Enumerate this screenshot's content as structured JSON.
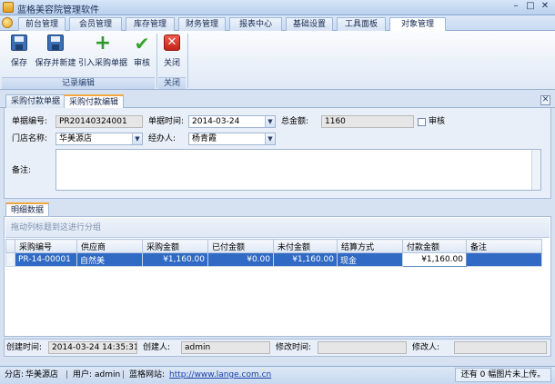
{
  "window": {
    "title": "蓝格美容院管理软件",
    "min": "–",
    "max": "□",
    "close": "✕"
  },
  "menu_tabs": [
    "前台管理",
    "会员管理",
    "库存管理",
    "财务管理",
    "报表中心",
    "基础设置",
    "工具面板",
    "对象管理"
  ],
  "ribbon": {
    "save": "保存",
    "save_new": "保存并新建",
    "import_po": "引入采购单据",
    "approve": "审核",
    "close": "关闭",
    "group_record": "记录编辑",
    "group_close": "关闭"
  },
  "doc_tabs": [
    "采购付款单据",
    "采购付款编辑"
  ],
  "form": {
    "doc_no_label": "单据编号:",
    "doc_no": "PR20140324001",
    "doc_time_label": "单据时间:",
    "doc_time": "2014-03-24",
    "total_label": "总金额:",
    "total": "1160",
    "approve_label": "审核",
    "store_label": "门店名称:",
    "store": "华美源店",
    "handler_label": "经办人:",
    "handler": "杨青霞",
    "remark_label": "备注:",
    "remark": ""
  },
  "detail_tab": "明细数据",
  "grid": {
    "group_hint": "拖动列标题到这进行分组",
    "columns": [
      "采购编号",
      "供应商",
      "采购金额",
      "已付金额",
      "未付金额",
      "结算方式",
      "付款金额",
      "备注"
    ],
    "rows": [
      {
        "indicator": "›",
        "po_no": "PR-14-00001",
        "supplier": "自然美",
        "purchase_amount": "¥1,160.00",
        "paid": "¥0.00",
        "unpaid": "¥1,160.00",
        "settle": "现金",
        "pay_amount": "¥1,160.00",
        "note": ""
      }
    ]
  },
  "info": {
    "created_time_label": "创建时间:",
    "created_time": "2014-03-24 14:35:31",
    "creator_label": "创建人:",
    "creator": "admin",
    "modified_time_label": "修改时间:",
    "modified_time": "",
    "modifier_label": "修改人:",
    "modifier": ""
  },
  "status": {
    "branch_label": "分店:",
    "branch": "华美源店",
    "user_label": "用户:",
    "user": "admin",
    "site_label": "蓝格网站:",
    "site_url": "http://www.lange.com.cn",
    "upload_msg": "还有 0 幅图片未上传。"
  },
  "colors": {
    "accent": "#f3a742",
    "selection": "#316ac5",
    "link": "#1a3fa8"
  }
}
